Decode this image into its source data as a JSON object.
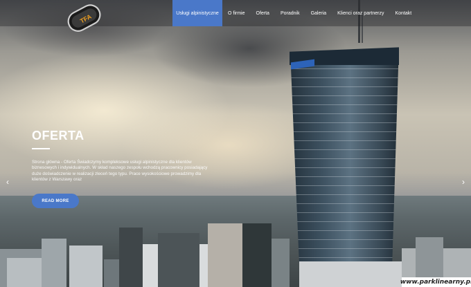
{
  "brand": {
    "logo_text": "TFA"
  },
  "nav": {
    "items": [
      {
        "label": "Usługi alpinistyczne",
        "active": true
      },
      {
        "label": "O firmie",
        "active": false
      },
      {
        "label": "Oferta",
        "active": false
      },
      {
        "label": "Poradnik",
        "active": false
      },
      {
        "label": "Galeria",
        "active": false
      },
      {
        "label": "Klienci oraz partnerzy",
        "active": false
      },
      {
        "label": "Kontakt",
        "active": false
      }
    ]
  },
  "slide": {
    "title": "OFERTA",
    "text": "Strona główna - Oferta Świadczymy kompleksowe usługi alpinistyczne dla klientów biznesowych i indywidualnych. W skład naszego zespołu wchodzą pracownicy posiadający duże doświadczenie w realizacji zleceń tego typu. Prace wysokościowe prowadzimy dla klientów z Warszawy oraz",
    "button_label": "READ MORE"
  },
  "carousel": {
    "prev_icon": "‹",
    "next_icon": "›"
  },
  "watermark": "www.parklinearny.pl",
  "colors": {
    "accent": "#4a78c9",
    "nav_overlay": "rgba(30,30,32,0.35)",
    "text": "#ffffff"
  }
}
